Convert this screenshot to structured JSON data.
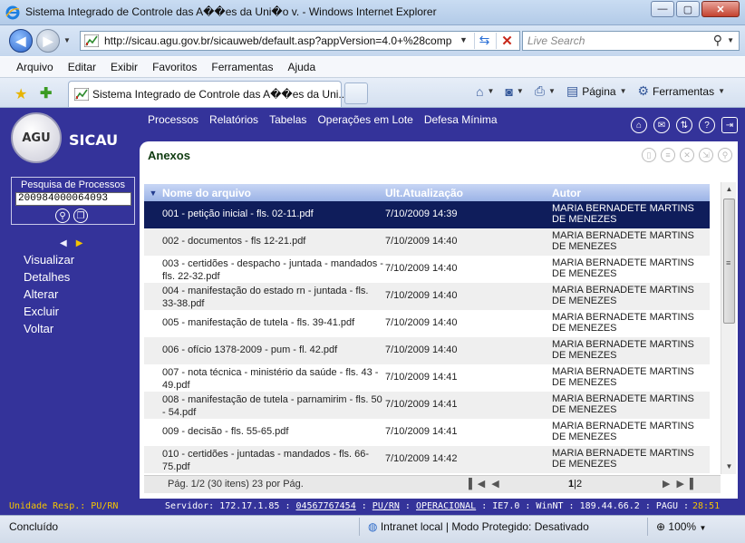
{
  "window": {
    "title": "Sistema Integrado de Controle das A��es da Uni�o v. - Windows Internet Explorer",
    "min_glyph": "—",
    "max_glyph": "▢",
    "close_glyph": "✕"
  },
  "address": {
    "url": "http://sicau.agu.gov.br/sicauweb/default.asp?appVersion=4.0+%28comp",
    "search_placeholder": "Live Search"
  },
  "menu": [
    "Arquivo",
    "Editar",
    "Exibir",
    "Favoritos",
    "Ferramentas",
    "Ajuda"
  ],
  "tab": {
    "label": "Sistema Integrado de Controle das A��es da Uni...",
    "page_label": "Página",
    "tools_label": "Ferramentas"
  },
  "app": {
    "logo_text": "AGU",
    "name": "SICAU",
    "search_label": "Pesquisa de Processos",
    "process_number": "200984000064093",
    "actions": [
      "Visualizar",
      "Detalhes",
      "Alterar",
      "Excluir",
      "Voltar"
    ],
    "topnav": [
      "Processos",
      "Relatórios",
      "Tabelas",
      "Operações em Lote",
      "Defesa Mínima"
    ],
    "heading": "Anexos",
    "columns": [
      "Nome do arquivo",
      "Ult.Atualização",
      "Autor"
    ],
    "rows": [
      {
        "name": "001 - petição inicial - fls. 02-11.pdf",
        "date": "7/10/2009 14:39",
        "author": "MARIA BERNADETE MARTINS DE MENEZES"
      },
      {
        "name": "002 - documentos - fls 12-21.pdf",
        "date": "7/10/2009 14:40",
        "author": "MARIA BERNADETE MARTINS DE MENEZES"
      },
      {
        "name": "003 - certidões - despacho - juntada - mandados - fls. 22-32.pdf",
        "date": "7/10/2009 14:40",
        "author": "MARIA BERNADETE MARTINS DE MENEZES"
      },
      {
        "name": "004 - manifestação do estado rn - juntada - fls. 33-38.pdf",
        "date": "7/10/2009 14:40",
        "author": "MARIA BERNADETE MARTINS DE MENEZES"
      },
      {
        "name": "005 - manifestação de tutela - fls. 39-41.pdf",
        "date": "7/10/2009 14:40",
        "author": "MARIA BERNADETE MARTINS DE MENEZES"
      },
      {
        "name": "006 - ofício 1378-2009 - pum - fl. 42.pdf",
        "date": "7/10/2009 14:40",
        "author": "MARIA BERNADETE MARTINS DE MENEZES"
      },
      {
        "name": "007 - nota técnica - ministério da saúde - fls. 43 - 49.pdf",
        "date": "7/10/2009 14:41",
        "author": "MARIA BERNADETE MARTINS DE MENEZES"
      },
      {
        "name": "008 - manifestação de tutela - parnamirim - fls. 50 - 54.pdf",
        "date": "7/10/2009 14:41",
        "author": "MARIA BERNADETE MARTINS DE MENEZES"
      },
      {
        "name": "009 - decisão - fls. 55-65.pdf",
        "date": "7/10/2009 14:41",
        "author": "MARIA BERNADETE MARTINS DE MENEZES"
      },
      {
        "name": "010 - certidões - juntadas - mandados - fls. 66-75.pdf",
        "date": "7/10/2009 14:42",
        "author": "MARIA BERNADETE MARTINS DE MENEZES"
      }
    ],
    "pager_text": "Pág. 1/2 (30 itens) 23 por Pág.",
    "pager_current": "1",
    "pager_other": "|2",
    "unit": "Unidade Resp.: PU/RN",
    "server_prefix": "Servidor: 172.17.1.85 : ",
    "server_user": "04567767454",
    "server_sep1": " : ",
    "server_unit": "PU/RN",
    "server_sep2": " : ",
    "server_mode": "OPERACIONAL",
    "server_rest": " : IE7.0 : WinNT : 189.44.66.2 : PAGU : ",
    "timer": "28:51"
  },
  "statusbar": {
    "done": "Concluído",
    "zone": "Intranet local | Modo Protegido: Desativado",
    "zoom": "100%"
  }
}
